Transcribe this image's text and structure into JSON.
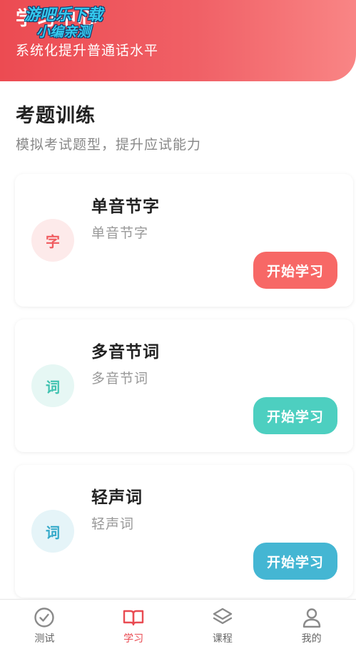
{
  "header": {
    "title": "学习中心",
    "subtitle": "系统化提升普通话水平",
    "watermark_line1": "游吧乐下载",
    "watermark_line2": "小编亲测"
  },
  "section": {
    "title": "考题训练",
    "subtitle": "模拟考试题型，提升应试能力"
  },
  "cards": [
    {
      "badge": "字",
      "title": "单音节字",
      "desc": "单音节字",
      "button": "开始学习",
      "badge_bg": "#fdeaea",
      "badge_color": "#f05b5f",
      "button_color": "#f76866"
    },
    {
      "badge": "词",
      "title": "多音节词",
      "desc": "多音节词",
      "button": "开始学习",
      "badge_bg": "#e6f7f4",
      "badge_color": "#3fc2b0",
      "button_color": "#4dcfc0"
    },
    {
      "badge": "词",
      "title": "轻声词",
      "desc": "轻声词",
      "button": "开始学习",
      "badge_bg": "#e5f4f8",
      "badge_color": "#34a9c9",
      "button_color": "#44b6d3"
    }
  ],
  "tabs": [
    {
      "label": "测试",
      "icon": "check-circle-icon"
    },
    {
      "label": "学习",
      "icon": "book-icon"
    },
    {
      "label": "课程",
      "icon": "layers-icon"
    },
    {
      "label": "我的",
      "icon": "user-icon"
    }
  ],
  "active_tab": "学习",
  "colors": {
    "accent": "#e94b52",
    "inactive_icon": "#8a8a8a"
  }
}
